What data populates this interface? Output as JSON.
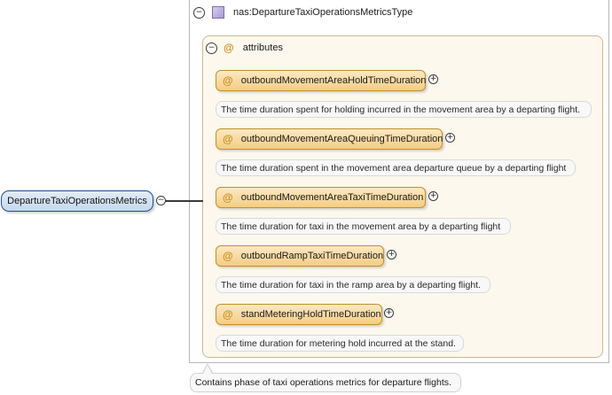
{
  "root": {
    "label": "DepartureTaxiOperationsMetrics",
    "toggle": "−"
  },
  "type": {
    "toggle": "−",
    "name": "nas:DepartureTaxiOperationsMetricsType",
    "doc": "Contains phase of taxi operations metrics for departure flights."
  },
  "attributes": {
    "toggle": "−",
    "icon": "@",
    "label": "attributes",
    "items": [
      {
        "icon": "@",
        "name": "outboundMovementAreaHoldTimeDuration",
        "expand": "+",
        "doc": "The time duration spent for holding incurred in the movement area by a departing flight."
      },
      {
        "icon": "@",
        "name": "outboundMovementAreaQueuingTimeDuration",
        "expand": "+",
        "doc": "The time duration spent in the movement area departure queue by a departing flight"
      },
      {
        "icon": "@",
        "name": "outboundMovementAreaTaxiTimeDuration",
        "expand": "+",
        "doc": "The time duration for taxi in the movement area by a departing flight"
      },
      {
        "icon": "@",
        "name": "outboundRampTaxiTimeDuration",
        "expand": "+",
        "doc": "The time duration for taxi in the ramp area by a departing flight."
      },
      {
        "icon": "@",
        "name": "standMeteringHoldTimeDuration",
        "expand": "+",
        "doc": "The time duration for metering hold incurred at the stand."
      }
    ]
  }
}
